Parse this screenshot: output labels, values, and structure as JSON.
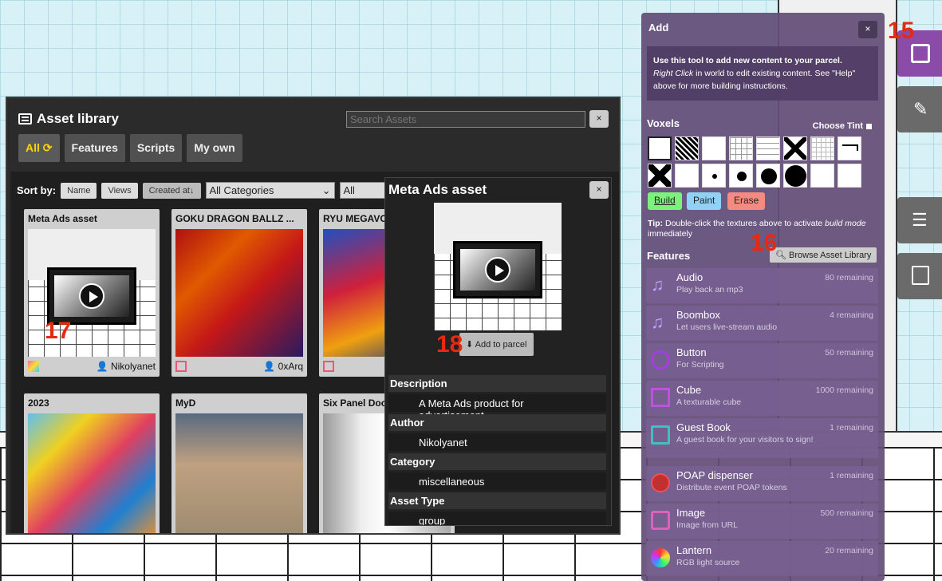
{
  "asset_library": {
    "title": "Asset library",
    "search_placeholder": "Search Assets",
    "close": "×",
    "tabs": [
      "All",
      "Features",
      "Scripts",
      "My own"
    ],
    "sort_label": "Sort by:",
    "sort_buttons": [
      "Name",
      "Views",
      "Created at↓"
    ],
    "category_select": "All Categories",
    "type_select": "All Types",
    "cards": [
      {
        "name": "Meta Ads asset",
        "author": "Nikolyanet"
      },
      {
        "name": "GOKU DRAGON BALLZ ...",
        "author": "0xArq"
      },
      {
        "name": "RYU MEGAVO",
        "author": ""
      },
      {
        "name": "2023",
        "author": ""
      },
      {
        "name": "MyD",
        "author": ""
      },
      {
        "name": "Six Panel Doo",
        "author": ""
      }
    ]
  },
  "detail": {
    "title": "Meta Ads asset",
    "close": "×",
    "add_button": "Add to parcel",
    "rows": [
      {
        "label": "Description",
        "value": "A Meta Ads product for advertisement"
      },
      {
        "label": "Author",
        "value": "Nikolyanet"
      },
      {
        "label": "Category",
        "value": "miscellaneous"
      },
      {
        "label": "Asset Type",
        "value": "group"
      }
    ]
  },
  "add_panel": {
    "title": "Add",
    "close": "×",
    "info_line1": "Use this tool to add new content to your parcel.",
    "info_line2_em": "Right Click",
    "info_line2_rest": " in world to edit existing content. See \"Help\" above for more building instructions.",
    "voxels_label": "Voxels",
    "choose_tint": "Choose Tint",
    "modes": [
      "Build",
      "Paint",
      "Erase"
    ],
    "tip_bold": "Tip:",
    "tip_text": " Double-click the textures above to activate ",
    "tip_em": "build mode",
    "tip_end": " immediately",
    "features_label": "Features",
    "browse_button": "Browse Asset Library",
    "features": [
      {
        "name": "Audio",
        "desc": "Play back an mp3",
        "remaining": "80 remaining",
        "icon": "music-note-icon"
      },
      {
        "name": "Boombox",
        "desc": "Let users live-stream audio",
        "remaining": "4 remaining",
        "icon": "music-note-icon"
      },
      {
        "name": "Button",
        "desc": "For Scripting",
        "remaining": "50 remaining",
        "icon": "button-icon"
      },
      {
        "name": "Cube",
        "desc": "A texturable cube",
        "remaining": "1000 remaining",
        "icon": "cube-icon"
      },
      {
        "name": "Guest Book",
        "desc": "A guest book for your visitors to sign!",
        "remaining": "1 remaining",
        "icon": "book-icon"
      },
      {
        "name": "POAP dispenser",
        "desc": "Distribute event POAP tokens",
        "remaining": "1 remaining",
        "icon": "poap-icon"
      },
      {
        "name": "Image",
        "desc": "Image from URL",
        "remaining": "500 remaining",
        "icon": "image-icon"
      },
      {
        "name": "Lantern",
        "desc": "RGB light source",
        "remaining": "20 remaining",
        "icon": "lantern-icon"
      }
    ]
  },
  "annotations": [
    "15",
    "16",
    "17",
    "18"
  ]
}
